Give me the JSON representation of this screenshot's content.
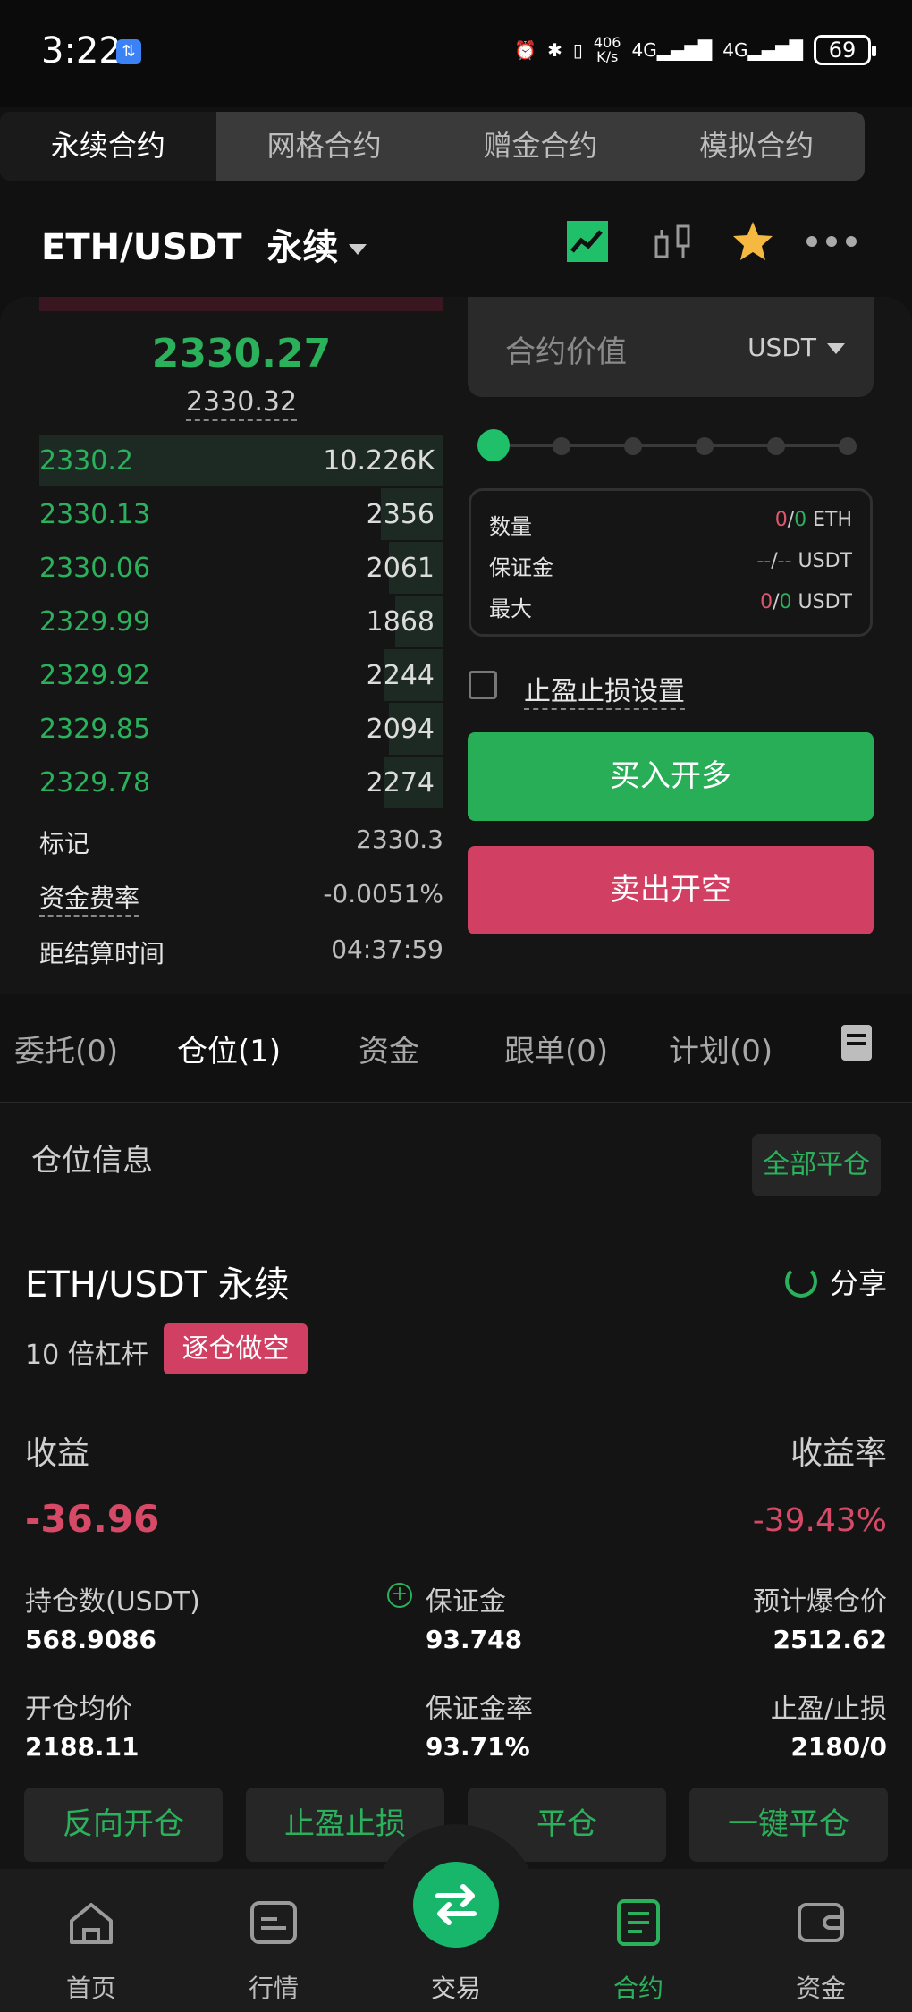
{
  "status_bar": {
    "time": "3:22",
    "net_speed_top": "406",
    "net_speed_bottom": "K/s",
    "signal1": "4G",
    "signal2": "4G",
    "battery": "69"
  },
  "top_tabs": [
    {
      "label": "永续合约",
      "active": true
    },
    {
      "label": "网格合约",
      "active": false
    },
    {
      "label": "赠金合约",
      "active": false
    },
    {
      "label": "模拟合约",
      "active": false
    }
  ],
  "header": {
    "pair": "ETH/USDT",
    "type": "永续",
    "icons": [
      "chart-line-icon",
      "candlestick-icon",
      "star-icon",
      "more-icon"
    ]
  },
  "orderbook": {
    "last_price": "2330.27",
    "index_price": "2330.32",
    "rows": [
      {
        "price": "2330.2",
        "qty": "10.226K",
        "depth": 1.0
      },
      {
        "price": "2330.13",
        "qty": "2356",
        "depth": 0.155
      },
      {
        "price": "2330.06",
        "qty": "2061",
        "depth": 0.135
      },
      {
        "price": "2329.99",
        "qty": "1868",
        "depth": 0.12
      },
      {
        "price": "2329.92",
        "qty": "2244",
        "depth": 0.145
      },
      {
        "price": "2329.85",
        "qty": "2094",
        "depth": 0.135
      },
      {
        "price": "2329.78",
        "qty": "2274",
        "depth": 0.147
      }
    ],
    "info": [
      {
        "label": "标记",
        "value": "2330.3",
        "dashed": false
      },
      {
        "label": "资金费率",
        "value": "-0.0051%",
        "dashed": true
      },
      {
        "label": "距结算时间",
        "value": "04:37:59",
        "dashed": false
      }
    ]
  },
  "order_form": {
    "amount_placeholder": "合约价值",
    "unit": "USDT",
    "slider_value_percent": 0,
    "stats": [
      {
        "label": "数量",
        "a": "0",
        "b": "0",
        "unit": "ETH"
      },
      {
        "label": "保证金",
        "a": "--",
        "b": "--",
        "unit": "USDT"
      },
      {
        "label": "最大",
        "a": "0",
        "b": "0",
        "unit": "USDT"
      }
    ],
    "tpsl_label": "止盈止损设置",
    "buy_label": "买入开多",
    "sell_label": "卖出开空"
  },
  "lower_tabs": [
    {
      "label": "委托(0)",
      "active": false
    },
    {
      "label": "仓位(1)",
      "active": true
    },
    {
      "label": "资金",
      "active": false
    },
    {
      "label": "跟单(0)",
      "active": false
    },
    {
      "label": "计划(0)",
      "active": false
    }
  ],
  "position": {
    "section_title": "仓位信息",
    "close_all": "全部平仓",
    "pair": "ETH/USDT 永续",
    "share": "分享",
    "leverage": "10 倍杠杆",
    "side_badge": "逐仓做空",
    "profit_label": "收益",
    "profit_rate_label": "收益率",
    "profit": "-36.96",
    "profit_rate": "-39.43%",
    "fields": [
      {
        "label": "持仓数(USDT)",
        "value": "568.9086"
      },
      {
        "label": "保证金",
        "value": "93.748"
      },
      {
        "label": "预计爆仓价",
        "value": "2512.62"
      },
      {
        "label": "开仓均价",
        "value": "2188.11"
      },
      {
        "label": "保证金率",
        "value": "93.71%"
      },
      {
        "label": "止盈/止损",
        "value": "2180/0"
      }
    ],
    "actions": [
      "反向开仓",
      "止盈止损",
      "平仓",
      "一键平仓"
    ]
  },
  "bottom_nav": [
    {
      "label": "首页",
      "icon": "home-icon",
      "active": false
    },
    {
      "label": "行情",
      "icon": "market-icon",
      "active": false
    },
    {
      "label": "交易",
      "icon": "swap-icon",
      "active": false
    },
    {
      "label": "合约",
      "icon": "contract-icon",
      "active": true
    },
    {
      "label": "资金",
      "icon": "wallet-icon",
      "active": false
    }
  ],
  "colors": {
    "green": "#2bb05c",
    "red": "#d13f63",
    "background": "#111111"
  }
}
